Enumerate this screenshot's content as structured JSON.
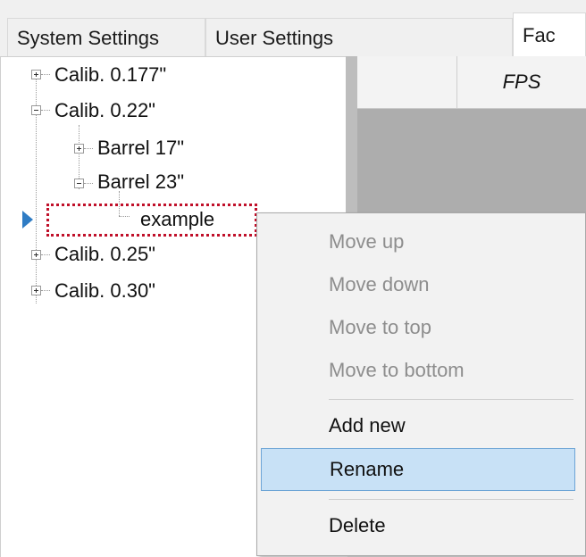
{
  "tabs": [
    {
      "label": "System Settings"
    },
    {
      "label": "User Settings"
    },
    {
      "label": "Fac"
    }
  ],
  "tree": {
    "nodes": [
      {
        "label": "Calib. 0.177\"",
        "expanded": false
      },
      {
        "label": "Calib. 0.22\"",
        "expanded": true
      },
      {
        "label": "Barrel 17\"",
        "expanded": false
      },
      {
        "label": "Barrel 23\"",
        "expanded": true
      },
      {
        "label": "example",
        "selected": true
      },
      {
        "label": "Calib. 0.25\"",
        "expanded": false
      },
      {
        "label": "Calib. 0.30\"",
        "expanded": false
      }
    ]
  },
  "grid": {
    "columns": [
      {
        "label": ""
      },
      {
        "label": "FPS"
      }
    ]
  },
  "context_menu": {
    "items": [
      {
        "label": "Move up",
        "enabled": false
      },
      {
        "label": "Move down",
        "enabled": false
      },
      {
        "label": "Move to top",
        "enabled": false
      },
      {
        "label": "Move to bottom",
        "enabled": false
      },
      {
        "label": "Add new",
        "enabled": true
      },
      {
        "label": "Rename",
        "enabled": true,
        "highlighted": true
      },
      {
        "label": "Delete",
        "enabled": true
      }
    ]
  },
  "colors": {
    "selection_border": "#c0102a",
    "row_marker": "#2f7cc4",
    "menu_highlight": "#c8e1f6"
  }
}
